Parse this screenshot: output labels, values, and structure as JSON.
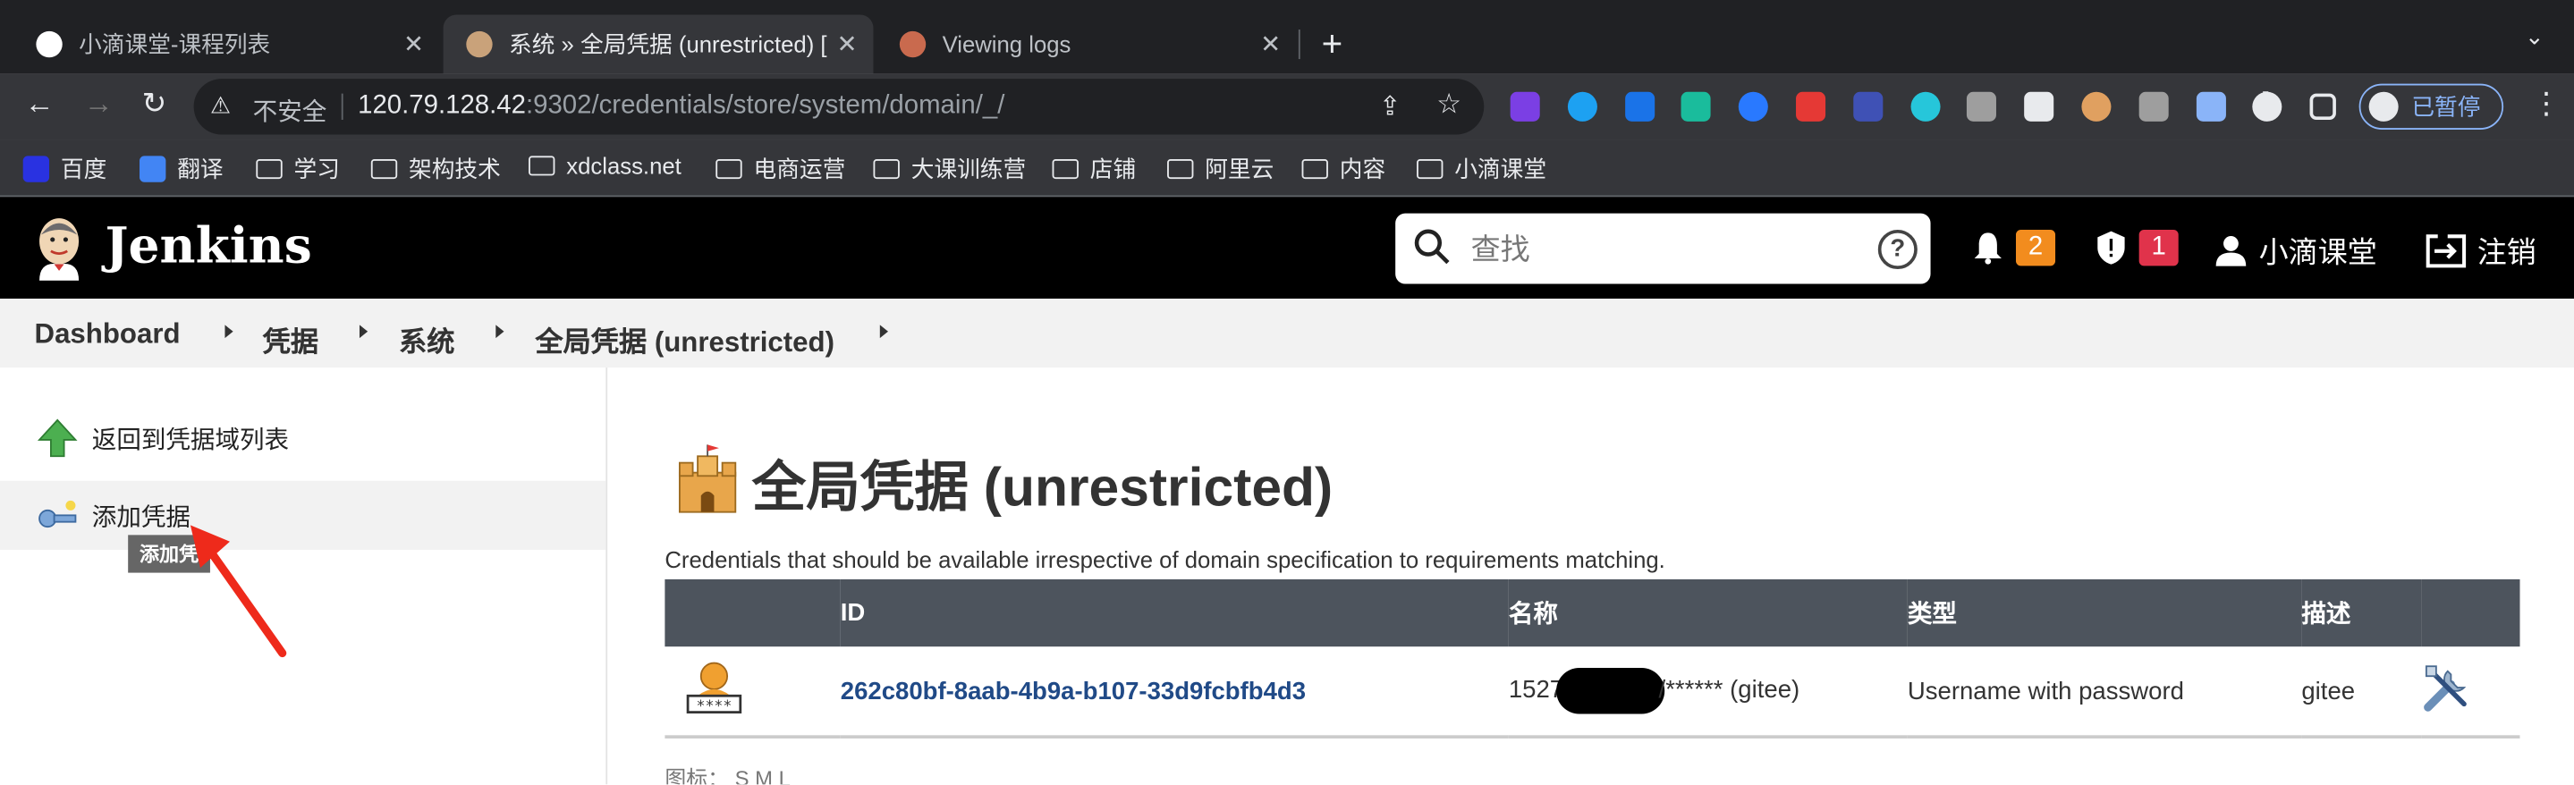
{
  "browser": {
    "tabs": [
      {
        "title": "小滴课堂-课程列表",
        "active": false,
        "favicon_color": "#ffffff"
      },
      {
        "title": "系统 » 全局凭据 (unrestricted) [",
        "active": true,
        "favicon_color": "#c9a27a"
      },
      {
        "title": "Viewing logs",
        "active": false,
        "favicon_color": "#c96a4e"
      }
    ],
    "new_tab": "+",
    "address": {
      "security_label": "不安全",
      "host": "120.79.128.42",
      "path": ":9302/credentials/store/system/domain/_/"
    },
    "profile_label": "已暂停",
    "extension_colors": [
      "#7b3fe4",
      "#1da1f2",
      "#1a73e8",
      "#1abc9c",
      "#2979ff",
      "#e53935",
      "#3f51b5",
      "#26c6da",
      "#9e9e9e",
      "#e8eaed",
      "#e0a060",
      "#9e9e9e",
      "#8ab4f8",
      "#e8eaed"
    ]
  },
  "bookmarks": [
    {
      "label": "百度",
      "type": "site",
      "color": "#2932e1"
    },
    {
      "label": "翻译",
      "type": "site",
      "color": "#4285f4"
    },
    {
      "label": "学习",
      "type": "folder"
    },
    {
      "label": "架构技术",
      "type": "folder"
    },
    {
      "label": "xdclass.net",
      "type": "folder"
    },
    {
      "label": "电商运营",
      "type": "folder"
    },
    {
      "label": "大课训练营",
      "type": "folder"
    },
    {
      "label": "店铺",
      "type": "folder"
    },
    {
      "label": "阿里云",
      "type": "folder"
    },
    {
      "label": "内容",
      "type": "folder"
    },
    {
      "label": "小滴课堂",
      "type": "folder"
    }
  ],
  "jenkins": {
    "brand": "Jenkins",
    "search_placeholder": "查找",
    "help": "?",
    "notifications_count": "2",
    "security_count": "1",
    "user": "小滴课堂",
    "logout": "注销",
    "colors": {
      "notif_badge": "#f28c1e",
      "security_badge": "#e0334b"
    }
  },
  "breadcrumbs": [
    "Dashboard",
    "凭据",
    "系统",
    "全局凭据 (unrestricted)"
  ],
  "sidebar": {
    "tasks": [
      {
        "label": "返回到凭据域列表",
        "icon": "up-arrow-icon"
      },
      {
        "label": "添加凭据",
        "icon": "key-icon"
      }
    ],
    "tooltip": "添加凭"
  },
  "main": {
    "title": "全局凭据 (unrestricted)",
    "description": "Credentials that should be available irrespective of domain specification to requirements matching.",
    "table": {
      "headers": [
        "",
        "ID",
        "名称",
        "类型",
        "描述",
        ""
      ],
      "rows": [
        {
          "id": "262c80bf-8aab-4b9a-b107-33d9fcbfb4d3",
          "name_prefix": "1527",
          "name_suffix": "/****** (gitee)",
          "type": "Username with password",
          "description": "gitee"
        }
      ]
    },
    "legend": "图标：  S   M   L"
  }
}
